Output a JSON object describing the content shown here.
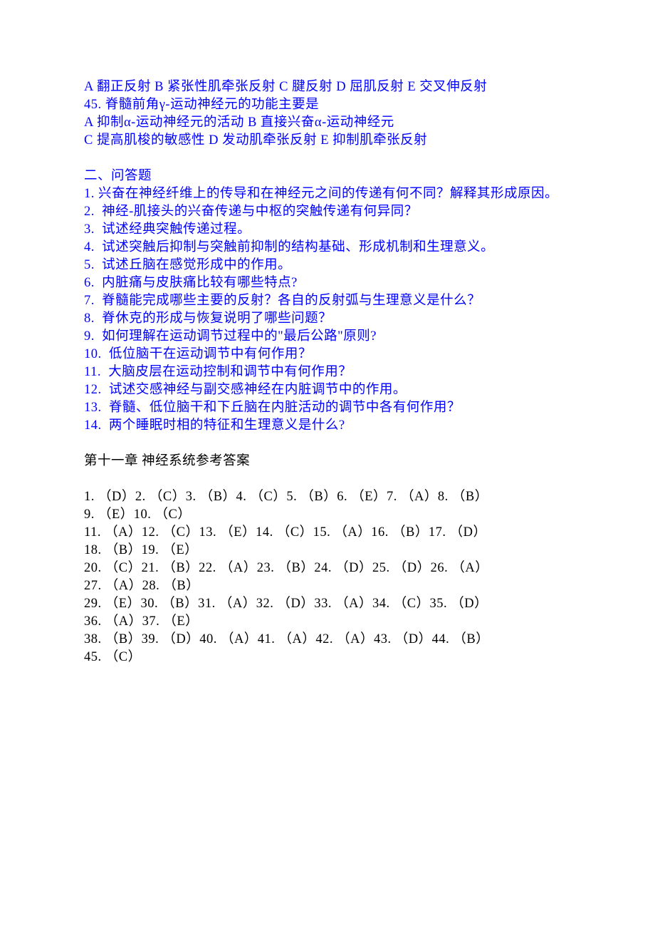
{
  "q44_options": "A 翻正反射 B 紧张性肌牵张反射 C 腱反射 D 屈肌反射 E 交叉伸反射",
  "q45_stem": "45. 脊髓前角γ-运动神经元的功能主要是",
  "q45_opt_line1": "A 抑制α-运动神经元的活动 B 直接兴奋α-运动神经元",
  "q45_opt_line2": "C 提高肌梭的敏感性 D 发动肌牵张反射 E 抑制肌牵张反射",
  "section2_header": "二、问答题",
  "essay": {
    "1": "1. 兴奋在神经纤维上的传导和在神经元之间的传递有何不同？解释其形成原因。",
    "2": "2.  神经-肌接头的兴奋传递与中枢的突触传递有何异同？",
    "3": "3.  试述经典突触传递过程。",
    "4": "4.  试述突触后抑制与突触前抑制的结构基础、形成机制和生理意义。",
    "5": "5.  试述丘脑在感觉形成中的作用。",
    "6": "6.  内脏痛与皮肤痛比较有哪些特点?",
    "7": "7.  脊髓能完成哪些主要的反射？各自的反射弧与生理意义是什么？",
    "8": "8.  脊休克的形成与恢复说明了哪些问题？",
    "9": "9.  如何理解在运动调节过程中的\"最后公路\"原则?",
    "10": "10.  低位脑干在运动调节中有何作用？",
    "11": "11.  大脑皮层在运动控制和调节中有何作用？",
    "12": "12.  试述交感神经与副交感神经在内脏调节中的作用。",
    "13": "13.  脊髓、低位脑干和下丘脑在内脏活动的调节中各有何作用？",
    "14": "14.  两个睡眠时相的特征和生理意义是什么?"
  },
  "answers_header": "第十一章 神经系统参考答案",
  "answers": {
    "r1": "1. （D）2. （C）3. （B）4. （C）5. （B）6. （E）7. （A）8. （B）",
    "r2": "9. （E）10. （C）",
    "r3": "11. （A）12. （C）13. （E）14. （C）15. （A）16. （B）17. （D）",
    "r4": "18. （B）19. （E）",
    "r5": "20. （C）21. （B）22. （A）23. （B）24. （D）25. （D）26. （A）",
    "r6": "27. （A）28. （B）",
    "r7": "29. （E）30. （B）31. （A）32. （D）33. （A）34. （C）35. （D）",
    "r8": "36. （A）37. （E）",
    "r9": "38. （B）39. （D）40. （A）41. （A）42. （A）43. （D）44. （B）",
    "r10": "45. （C）"
  }
}
